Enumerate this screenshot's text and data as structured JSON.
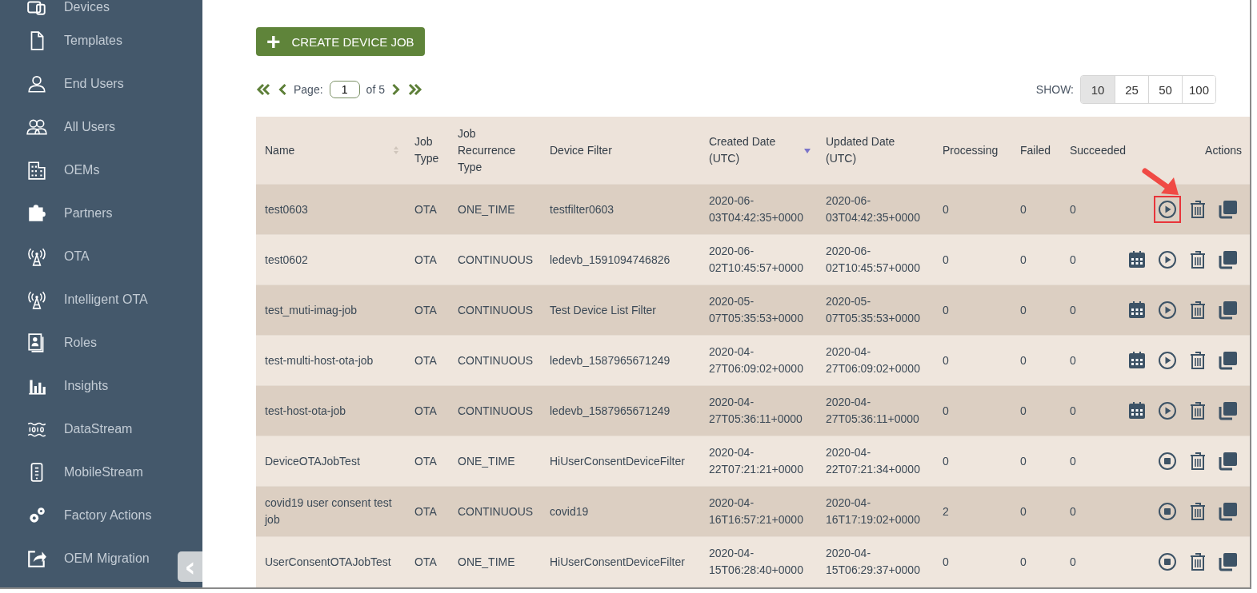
{
  "sidebar": {
    "items": [
      {
        "label": "Devices",
        "kind": "devices"
      },
      {
        "label": "Templates",
        "kind": "document"
      },
      {
        "label": "End Users",
        "kind": "user"
      },
      {
        "label": "All Users",
        "kind": "users"
      },
      {
        "label": "OEMs",
        "kind": "building"
      },
      {
        "label": "Partners",
        "kind": "puzzle"
      },
      {
        "label": "OTA",
        "kind": "antenna"
      },
      {
        "label": "Intelligent OTA",
        "kind": "antenna"
      },
      {
        "label": "Roles",
        "kind": "cards"
      },
      {
        "label": "Insights",
        "kind": "bars"
      },
      {
        "label": "DataStream",
        "kind": "binary"
      },
      {
        "label": "MobileStream",
        "kind": "phone"
      },
      {
        "label": "Factory Actions",
        "kind": "gears"
      },
      {
        "label": "OEM Migration",
        "kind": "export"
      }
    ],
    "collapse_glyph": "‹"
  },
  "create_button": {
    "icon": "+",
    "label": "CREATE DEVICE JOB"
  },
  "pagination": {
    "label": "Page:",
    "value": "1",
    "total": "of 5"
  },
  "page_size": {
    "label": "SHOW:",
    "options": [
      {
        "label": "10",
        "selected": true
      },
      {
        "label": "25",
        "selected": false
      },
      {
        "label": "50",
        "selected": false
      },
      {
        "label": "100",
        "selected": false
      }
    ]
  },
  "table": {
    "columns": [
      {
        "label": "Name",
        "sortable": true,
        "sorted": false
      },
      {
        "label": "Job Type",
        "sortable": false,
        "sorted": false
      },
      {
        "label": "Job Recurrence Type",
        "sortable": false,
        "sorted": false
      },
      {
        "label": "Device Filter",
        "sortable": false,
        "sorted": false
      },
      {
        "label": "Created Date (UTC)",
        "sortable": false,
        "sorted": true
      },
      {
        "label": "Updated Date (UTC)",
        "sortable": false,
        "sorted": false
      },
      {
        "label": "Processing",
        "sortable": false,
        "sorted": false
      },
      {
        "label": "Failed",
        "sortable": false,
        "sorted": false
      },
      {
        "label": "Succeeded",
        "sortable": false,
        "sorted": false
      },
      {
        "label": "Actions",
        "sortable": false,
        "sorted": false
      }
    ],
    "rows": [
      {
        "cells": [
          "test0603",
          "OTA",
          "ONE_TIME",
          "testfilter0603",
          "2020-06-03T04:42:35+0000",
          "2020-06-03T04:42:35+0000",
          "0",
          "0",
          "0"
        ],
        "actions": [
          {
            "kind": "play"
          },
          {
            "kind": "delete"
          },
          {
            "kind": "copy"
          }
        ],
        "callout": true
      },
      {
        "cells": [
          "test0602",
          "OTA",
          "CONTINUOUS",
          "ledevb_1591094746826",
          "2020-06-02T10:45:57+0000",
          "2020-06-02T10:45:57+0000",
          "0",
          "0",
          "0"
        ],
        "actions": [
          {
            "kind": "schedule"
          },
          {
            "kind": "play"
          },
          {
            "kind": "delete"
          },
          {
            "kind": "copy"
          }
        ],
        "callout": false
      },
      {
        "cells": [
          "test_muti-imag-job",
          "OTA",
          "CONTINUOUS",
          "Test Device List Filter",
          "2020-05-07T05:35:53+0000",
          "2020-05-07T05:35:53+0000",
          "0",
          "0",
          "0"
        ],
        "actions": [
          {
            "kind": "schedule"
          },
          {
            "kind": "play"
          },
          {
            "kind": "delete"
          },
          {
            "kind": "copy"
          }
        ],
        "callout": false
      },
      {
        "cells": [
          "test-multi-host-ota-job",
          "OTA",
          "CONTINUOUS",
          "ledevb_1587965671249",
          "2020-04-27T06:09:02+0000",
          "2020-04-27T06:09:02+0000",
          "0",
          "0",
          "0"
        ],
        "actions": [
          {
            "kind": "schedule"
          },
          {
            "kind": "play"
          },
          {
            "kind": "delete"
          },
          {
            "kind": "copy"
          }
        ],
        "callout": false
      },
      {
        "cells": [
          "test-host-ota-job",
          "OTA",
          "CONTINUOUS",
          "ledevb_1587965671249",
          "2020-04-27T05:36:11+0000",
          "2020-04-27T05:36:11+0000",
          "0",
          "0",
          "0"
        ],
        "actions": [
          {
            "kind": "schedule"
          },
          {
            "kind": "play"
          },
          {
            "kind": "delete"
          },
          {
            "kind": "copy"
          }
        ],
        "callout": false
      },
      {
        "cells": [
          "DeviceOTAJobTest",
          "OTA",
          "ONE_TIME",
          "HiUserConsentDeviceFilter",
          "2020-04-22T07:21:21+0000",
          "2020-04-22T07:21:34+0000",
          "0",
          "0",
          "0"
        ],
        "actions": [
          {
            "kind": "stop"
          },
          {
            "kind": "delete"
          },
          {
            "kind": "copy"
          }
        ],
        "callout": false
      },
      {
        "cells": [
          "covid19 user consent test job",
          "OTA",
          "CONTINUOUS",
          "covid19",
          "2020-04-16T16:57:21+0000",
          "2020-04-16T17:19:02+0000",
          "2",
          "0",
          "0"
        ],
        "actions": [
          {
            "kind": "stop"
          },
          {
            "kind": "delete"
          },
          {
            "kind": "copy"
          }
        ],
        "callout": false
      },
      {
        "cells": [
          "UserConsentOTAJobTest",
          "OTA",
          "ONE_TIME",
          "HiUserConsentDeviceFilter",
          "2020-04-15T06:28:40+0000",
          "2020-04-15T06:29:37+0000",
          "0",
          "0",
          "0"
        ],
        "actions": [
          {
            "kind": "stop"
          },
          {
            "kind": "delete"
          },
          {
            "kind": "copy"
          }
        ],
        "callout": false
      }
    ]
  }
}
